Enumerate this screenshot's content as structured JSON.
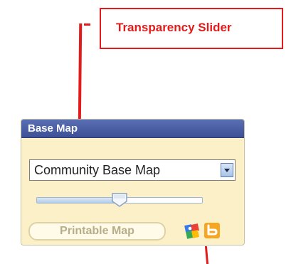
{
  "callout": {
    "text": "Transparency Slider"
  },
  "panel": {
    "title": "Base Map",
    "basemap_select": {
      "selected": "Community Base Map"
    },
    "transparency_slider": {
      "value": 0.5
    },
    "print_button": {
      "label": "Printable Map"
    },
    "icons": [
      "google-maps-icon",
      "bing-maps-icon"
    ]
  },
  "colors": {
    "callout_red": "#e31b1b",
    "header_blue": "#3d4f96",
    "panel_bg": "#fbf0c8"
  }
}
